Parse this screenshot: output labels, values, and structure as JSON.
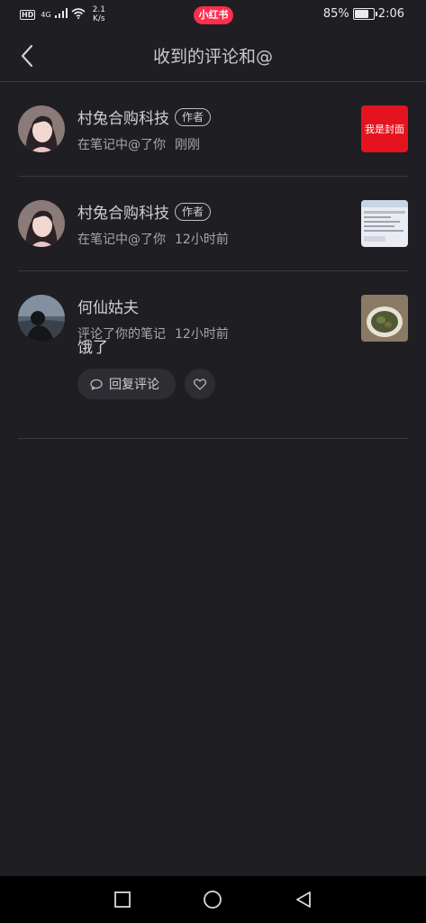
{
  "status_bar": {
    "hd": "HD",
    "network": "4G",
    "speed_value": "2.1",
    "speed_unit": "K/s",
    "app_badge": "小红书",
    "battery": "85%",
    "battery_level": 0.85,
    "time": "2:06"
  },
  "header": {
    "title": "收到的评论和@",
    "back_icon": "chevron-left-icon"
  },
  "notifications": [
    {
      "name": "村兔合购科技",
      "badge": "作者",
      "action": "在笔记中@了你",
      "time": "刚刚",
      "thumb_text": "我是封面"
    },
    {
      "name": "村兔合购科技",
      "badge": "作者",
      "action": "在笔记中@了你",
      "time": "12小时前",
      "thumb_text": ""
    },
    {
      "name": "何仙姑夫",
      "badge": "",
      "action": "评论了你的笔记",
      "time": "12小时前",
      "comment": "饿了",
      "reply_label": "回复评论"
    }
  ],
  "colors": {
    "background": "#1f1e23",
    "accent": "#ff2e4d",
    "divider": "#3a393f",
    "cover_red": "#e5131f"
  }
}
